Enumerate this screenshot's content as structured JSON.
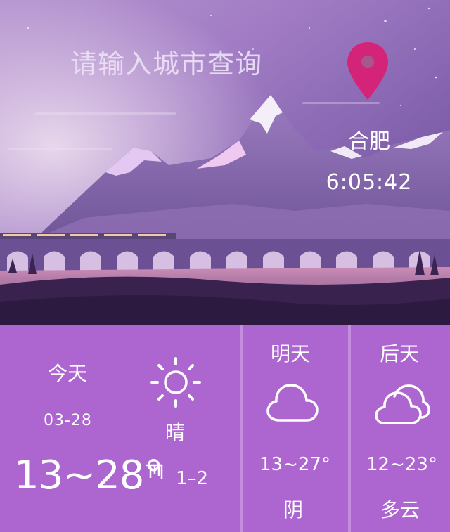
{
  "search": {
    "placeholder": "请输入城市查询"
  },
  "location": {
    "city": "合肥",
    "time": "6:05:42"
  },
  "today": {
    "label": "今天",
    "date": "03-28",
    "temp": "13~28°",
    "wind_icon": "wind-icon",
    "wind_level": "1–2",
    "condition": "晴",
    "icon": "sun-icon"
  },
  "tomorrow": {
    "label": "明天",
    "temp": "13~27°",
    "condition": "阴",
    "icon": "cloud-icon"
  },
  "after": {
    "label": "后天",
    "temp": "12~23°",
    "condition": "多云",
    "icon": "clouds-icon"
  },
  "colors": {
    "sky_top": "#7c5aa8",
    "sky_light": "#d9c6ea",
    "pin": "#d4247a",
    "panel": "#ad66cf",
    "divider": "#c48de0",
    "ground": "#321d4c"
  }
}
